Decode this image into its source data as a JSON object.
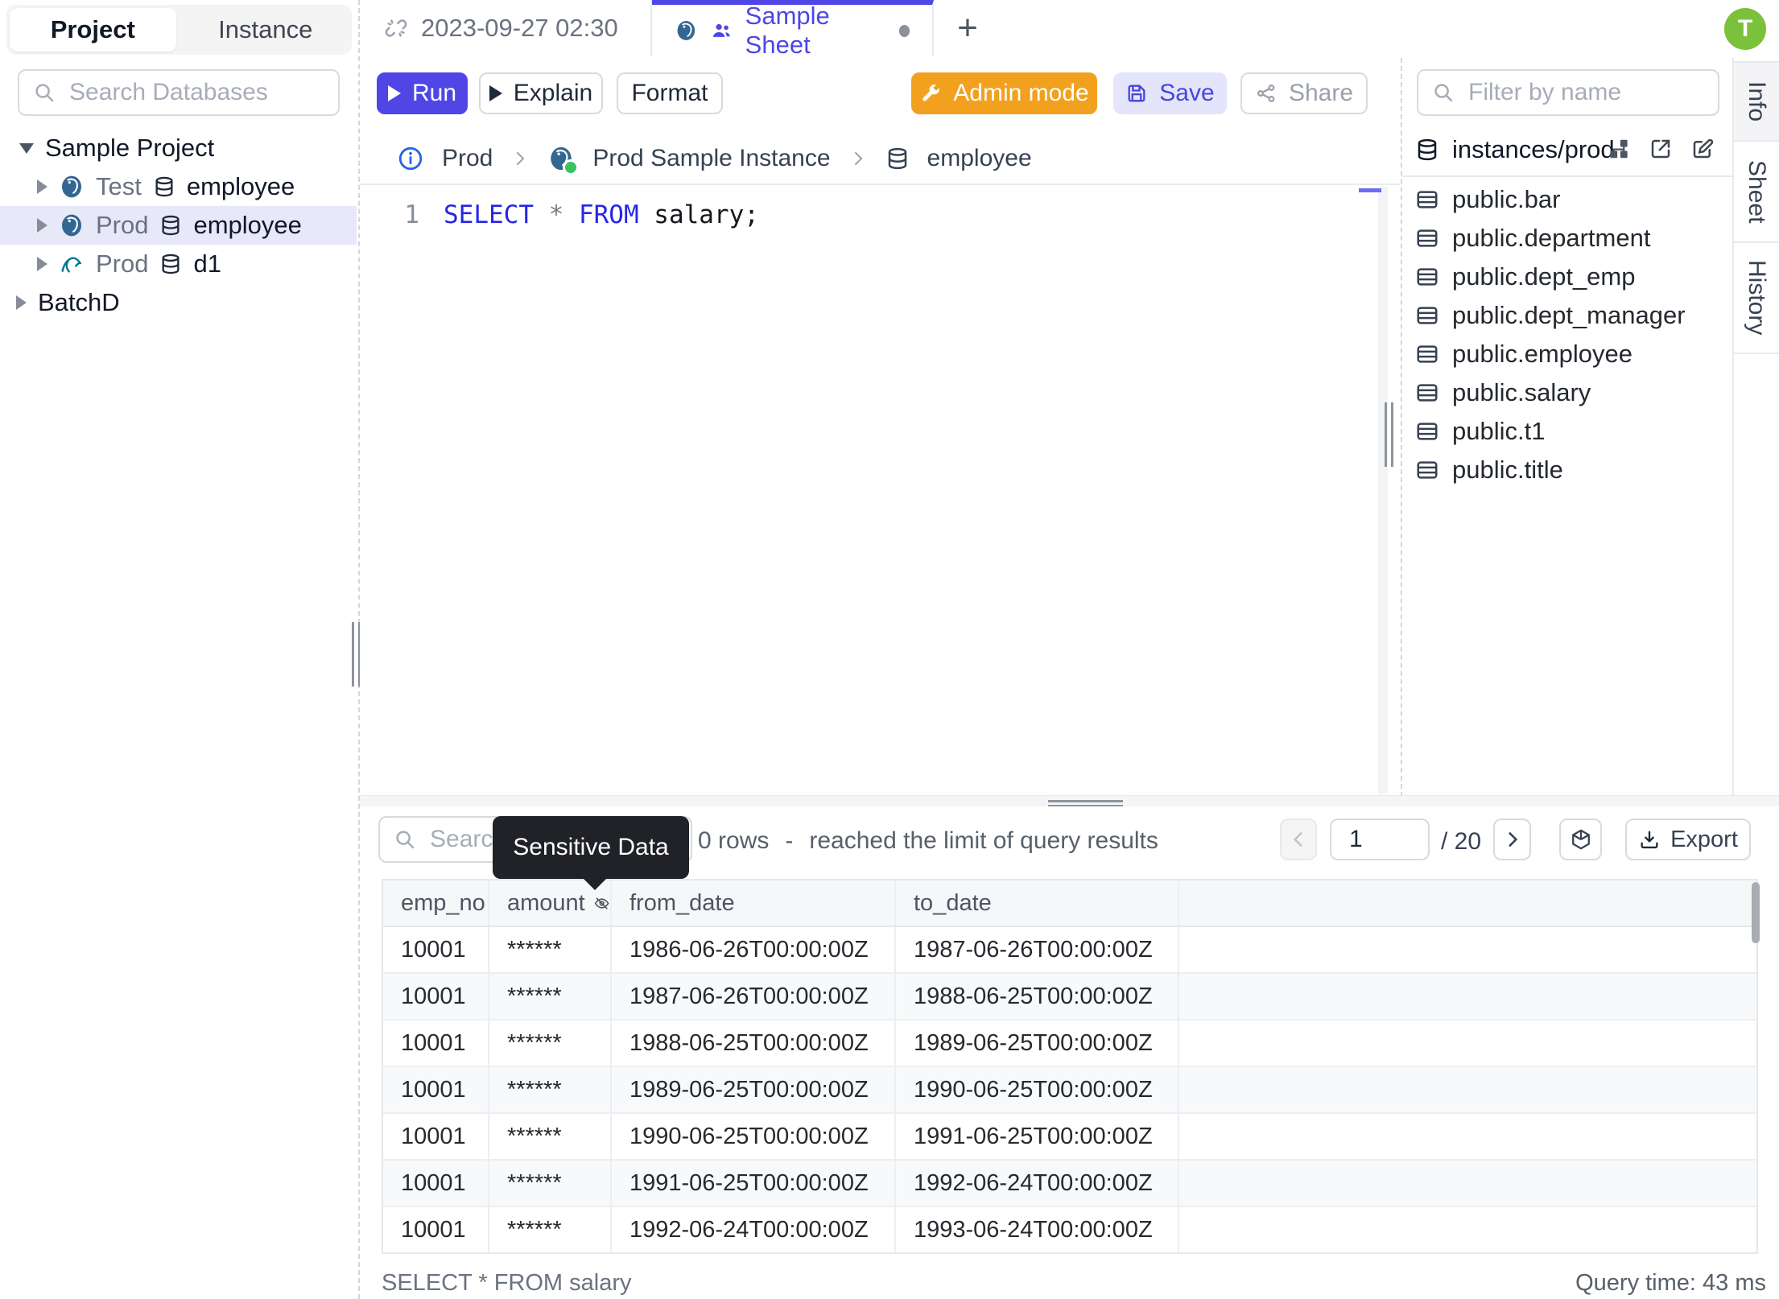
{
  "left_sidebar": {
    "tabs": [
      {
        "label": "Project"
      },
      {
        "label": "Instance"
      }
    ],
    "search_placeholder": "Search Databases",
    "tree": {
      "project_label": "Sample Project",
      "databases": [
        {
          "engine": "postgres",
          "env": "Test",
          "name": "employee"
        },
        {
          "engine": "postgres",
          "env": "Prod",
          "name": "employee"
        },
        {
          "engine": "mysql",
          "env": "Prod",
          "name": "d1"
        }
      ],
      "other_project_label": "BatchD"
    }
  },
  "tab_bar": {
    "tab1_label": "2023-09-27 02:30",
    "tab2_label": "Sample Sheet",
    "new_tab_label": "+",
    "avatar_initial": "T"
  },
  "toolbar": {
    "run_label": "Run",
    "explain_label": "Explain",
    "format_label": "Format",
    "admin_mode_label": "Admin mode",
    "save_label": "Save",
    "share_label": "Share"
  },
  "breadcrumb": {
    "environment": "Prod",
    "instance": "Prod Sample Instance",
    "database": "employee"
  },
  "editor": {
    "line_number": "1",
    "sql": {
      "kw1": "SELECT",
      "star": " * ",
      "kw2": "FROM",
      "rest": " salary;"
    }
  },
  "right_sidebar": {
    "filter_placeholder": "Filter by name",
    "connection": "instances/prod",
    "tables": [
      "public.bar",
      "public.department",
      "public.dept_emp",
      "public.dept_manager",
      "public.employee",
      "public.salary",
      "public.t1",
      "public.title"
    ]
  },
  "side_tabs": {
    "info": "Info",
    "sheet": "Sheet",
    "history": "History"
  },
  "results": {
    "search_placeholder": "Search",
    "tooltip": "Sensitive Data",
    "rows_info": "0 rows",
    "dash": "-",
    "limit_info": "reached the limit of query results",
    "page": "1",
    "page_total": "/ 20",
    "export_label": "Export",
    "table": {
      "columns": [
        "emp_no",
        "amount",
        "from_date",
        "to_date"
      ],
      "masked_column": "amount",
      "rows": [
        [
          "10001",
          "******",
          "1986-06-26T00:00:00Z",
          "1987-06-26T00:00:00Z"
        ],
        [
          "10001",
          "******",
          "1987-06-26T00:00:00Z",
          "1988-06-25T00:00:00Z"
        ],
        [
          "10001",
          "******",
          "1988-06-25T00:00:00Z",
          "1989-06-25T00:00:00Z"
        ],
        [
          "10001",
          "******",
          "1989-06-25T00:00:00Z",
          "1990-06-25T00:00:00Z"
        ],
        [
          "10001",
          "******",
          "1990-06-25T00:00:00Z",
          "1991-06-25T00:00:00Z"
        ],
        [
          "10001",
          "******",
          "1991-06-25T00:00:00Z",
          "1992-06-24T00:00:00Z"
        ],
        [
          "10001",
          "******",
          "1992-06-24T00:00:00Z",
          "1993-06-24T00:00:00Z"
        ]
      ]
    },
    "status_sql": "SELECT * FROM salary",
    "query_time": "Query time: 43 ms"
  },
  "icons": [
    "search-icon",
    "unlink-icon",
    "postgres-icon",
    "mysql-icon",
    "users-icon",
    "database-icon",
    "table-icon",
    "info-circle-icon",
    "wrench-icon",
    "save-icon",
    "share-icon",
    "sitemap-icon",
    "external-link-icon",
    "edit-icon",
    "chevron-left-icon",
    "chevron-right-icon",
    "cube-icon",
    "download-icon",
    "eye-off-icon",
    "plus-icon"
  ],
  "colors": {
    "accent": "#4f46e5",
    "admin_orange": "#f2a11f",
    "save_bg": "#e4e5fb",
    "selected_row_bg": "#e7e8f8",
    "avatar_green": "#7bc13c",
    "keyword_blue": "#2626e6",
    "tooltip_bg": "#202227",
    "status_green": "#37c45f"
  }
}
